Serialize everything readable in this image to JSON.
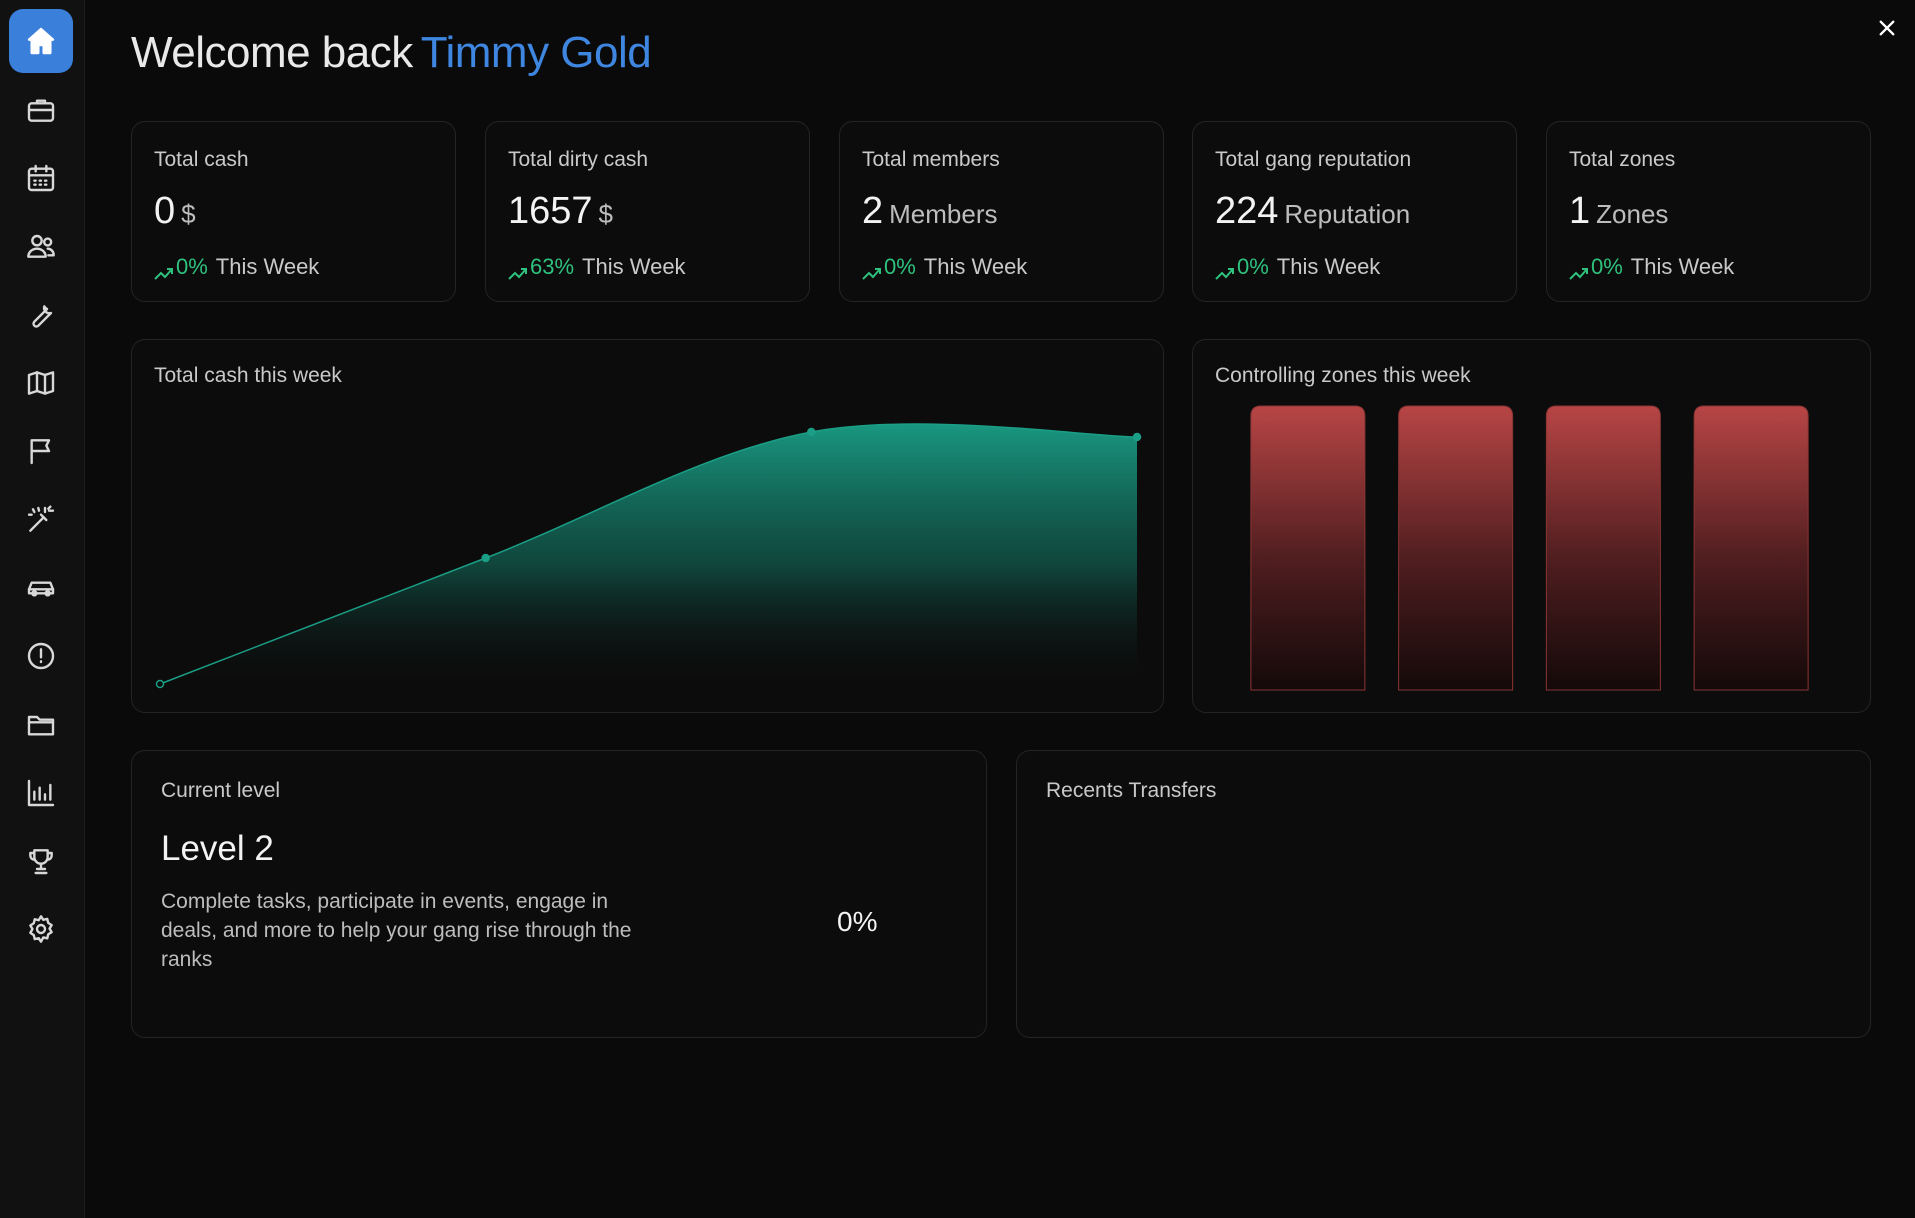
{
  "header": {
    "greeting": "Welcome back",
    "user_name": "Timmy Gold"
  },
  "sidebar": {
    "items": [
      {
        "icon": "home-icon",
        "active": true
      },
      {
        "icon": "briefcase-icon"
      },
      {
        "icon": "calendar-icon"
      },
      {
        "icon": "users-icon"
      },
      {
        "icon": "wrench-icon"
      },
      {
        "icon": "map-icon"
      },
      {
        "icon": "flag-icon"
      },
      {
        "icon": "magic-wand-icon"
      },
      {
        "icon": "car-icon"
      },
      {
        "icon": "alert-circle-icon"
      },
      {
        "icon": "folder-icon"
      },
      {
        "icon": "bar-chart-icon"
      },
      {
        "icon": "trophy-icon"
      },
      {
        "icon": "settings-icon"
      }
    ]
  },
  "stats": [
    {
      "title": "Total cash",
      "value": "0",
      "unit": "$",
      "change": "0%",
      "period": "This Week"
    },
    {
      "title": "Total dirty cash",
      "value": "1657",
      "unit": "$",
      "change": "63%",
      "period": "This Week"
    },
    {
      "title": "Total members",
      "value": "2",
      "unit": "Members",
      "change": "0%",
      "period": "This Week"
    },
    {
      "title": "Total gang reputation",
      "value": "224",
      "unit": "Reputation",
      "change": "0%",
      "period": "This Week"
    },
    {
      "title": "Total zones",
      "value": "1",
      "unit": "Zones",
      "change": "0%",
      "period": "This Week"
    }
  ],
  "cash_panel": {
    "title": "Total cash this week"
  },
  "zones_panel": {
    "title": "Controlling zones this week"
  },
  "level_panel": {
    "label": "Current level",
    "level": "Level 2",
    "description": "Complete tasks, participate in events, engage in deals, and more to help your gang rise through the ranks",
    "progress": "0%"
  },
  "transfers_panel": {
    "title": "Recents Transfers"
  },
  "colors": {
    "accent": "#3e86e0",
    "positive": "#2ec27e",
    "area_fill": "#1a9e86",
    "bar_fill": "#b84545"
  },
  "chart_data": [
    {
      "type": "area",
      "x": [
        1,
        2,
        3,
        4
      ],
      "y": [
        0.0,
        0.5,
        1.0,
        0.98
      ]
    },
    {
      "type": "bar",
      "values": [
        1,
        1,
        1,
        1
      ]
    }
  ]
}
